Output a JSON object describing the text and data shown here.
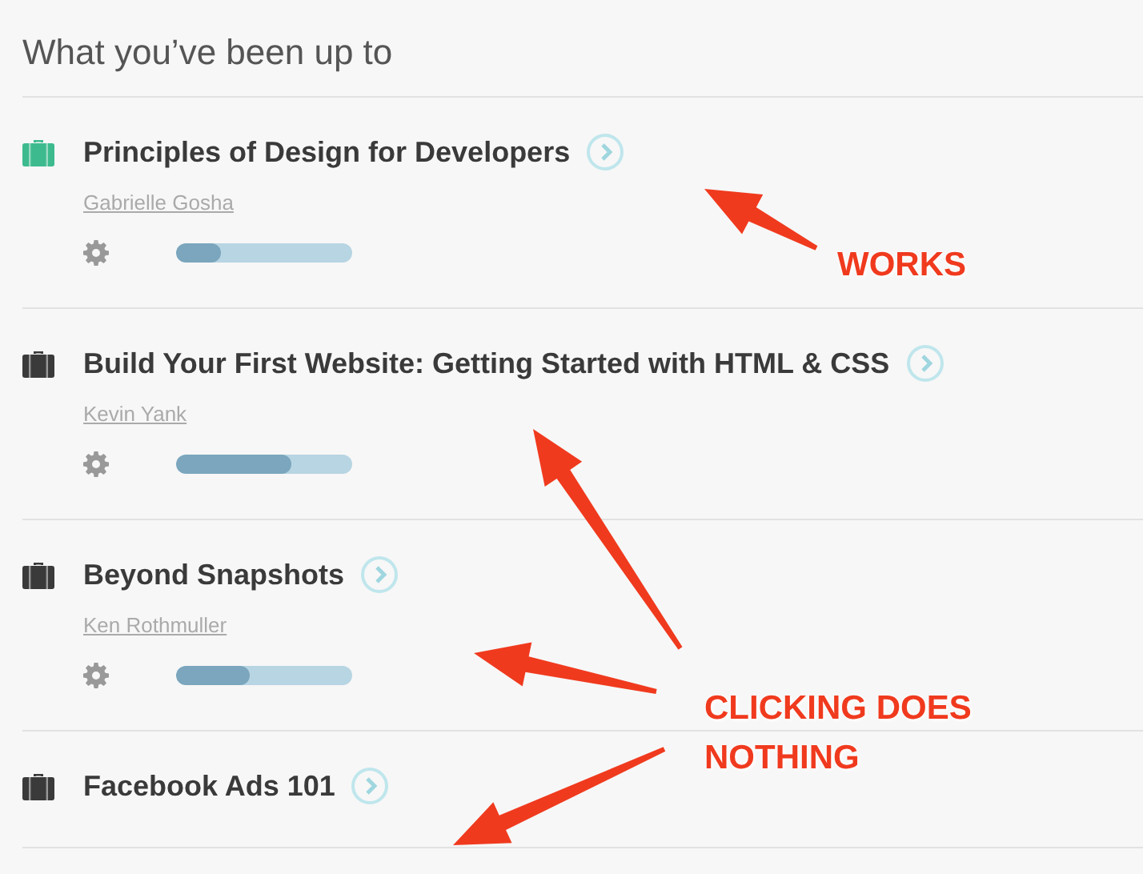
{
  "heading": "What you’ve been up to",
  "courses": [
    {
      "title": "Principles of Design for Developers",
      "author": "Gabrielle Gosha",
      "level": 0.25,
      "color": "#3dbb8e"
    },
    {
      "title": "Build Your First Website: Getting Started with HTML & CSS",
      "author": "Kevin Yank",
      "level": 0.65,
      "color": "#3a3a3a"
    },
    {
      "title": "Beyond Snapshots",
      "author": "Ken Rothmuller",
      "level": 0.42,
      "color": "#3a3a3a"
    },
    {
      "title": "Facebook Ads 101",
      "color": "#3a3a3a"
    }
  ],
  "annotations": [
    {
      "text": "WORKS"
    },
    {
      "text": "CLICKING DOES NOTHING"
    }
  ]
}
